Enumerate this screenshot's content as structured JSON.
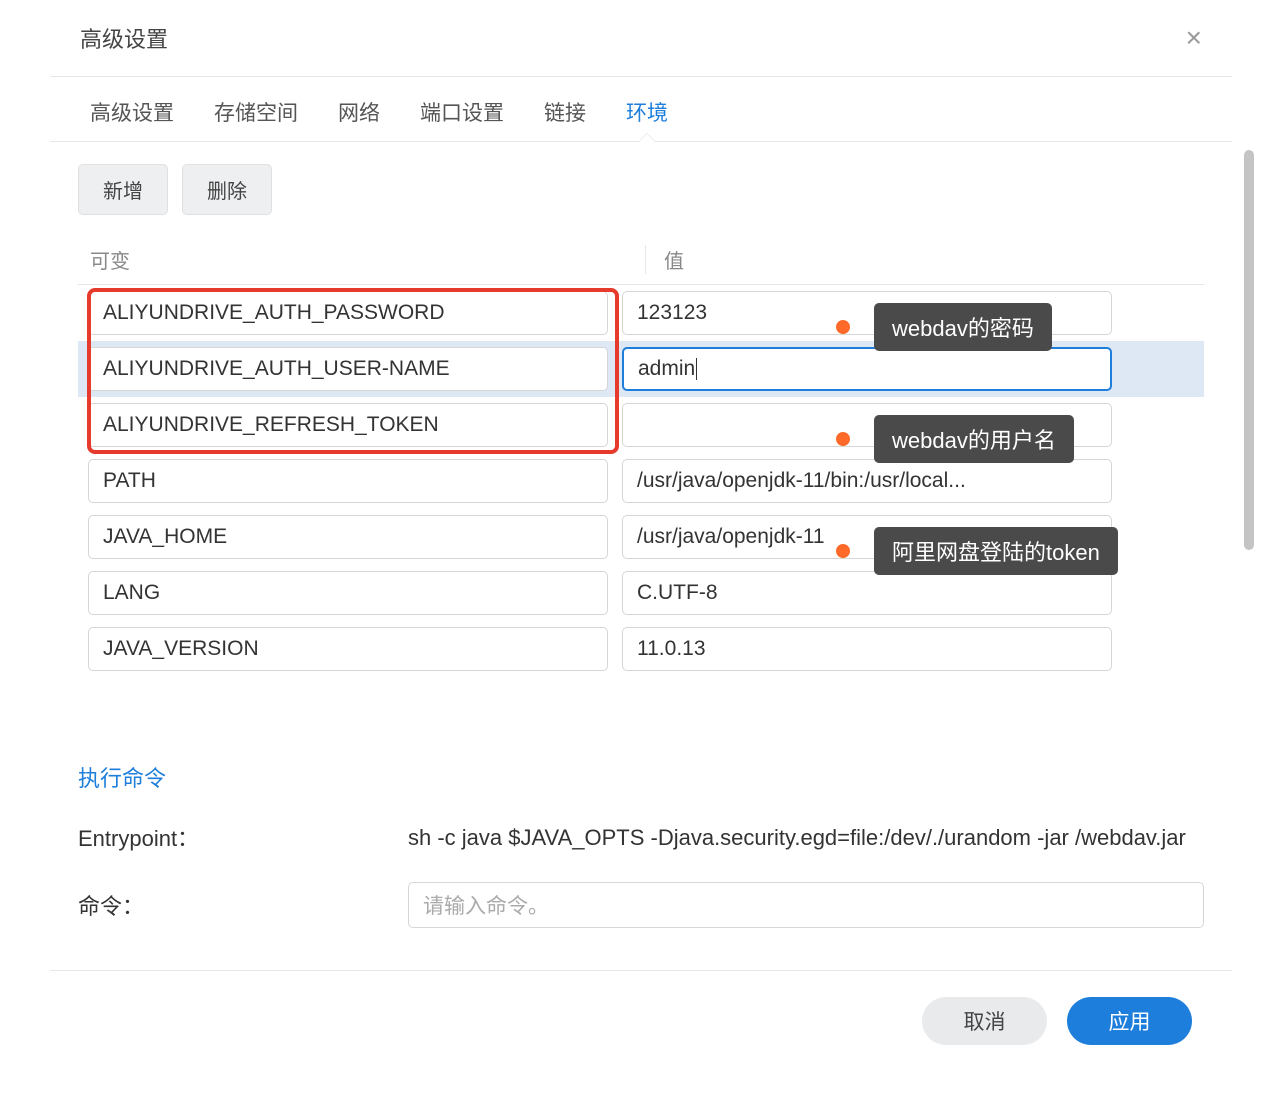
{
  "dialog": {
    "title": "高级设置"
  },
  "tabs": [
    {
      "label": "高级设置",
      "active": false
    },
    {
      "label": "存储空间",
      "active": false
    },
    {
      "label": "网络",
      "active": false
    },
    {
      "label": "端口设置",
      "active": false
    },
    {
      "label": "链接",
      "active": false
    },
    {
      "label": "环境",
      "active": true
    }
  ],
  "toolbar": {
    "add_label": "新增",
    "delete_label": "删除"
  },
  "table": {
    "col_key": "可变",
    "col_value": "值"
  },
  "env_rows": [
    {
      "key": "ALIYUNDRIVE_AUTH_PASSWORD",
      "value": "123123",
      "selected": false,
      "focused": false,
      "annotation": "webdav的密码"
    },
    {
      "key": "ALIYUNDRIVE_AUTH_USER-NAME",
      "value": "admin",
      "selected": true,
      "focused": true,
      "annotation": "webdav的用户名"
    },
    {
      "key": "ALIYUNDRIVE_REFRESH_TOKEN",
      "value": "",
      "selected": false,
      "focused": false,
      "annotation": "阿里网盘登陆的token"
    },
    {
      "key": "PATH",
      "value": "/usr/java/openjdk-11/bin:/usr/local...",
      "selected": false,
      "focused": false,
      "annotation": null
    },
    {
      "key": "JAVA_HOME",
      "value": "/usr/java/openjdk-11",
      "selected": false,
      "focused": false,
      "annotation": null
    },
    {
      "key": "LANG",
      "value": "C.UTF-8",
      "selected": false,
      "focused": false,
      "annotation": null
    },
    {
      "key": "JAVA_VERSION",
      "value": "11.0.13",
      "selected": false,
      "focused": false,
      "annotation": null
    }
  ],
  "exec_link": "执行命令",
  "entrypoint": {
    "label": "Entrypoint：",
    "value": "sh -c java $JAVA_OPTS -Djava.security.egd=file:/dev/./urandom -jar /webdav.jar"
  },
  "command": {
    "label": "命令：",
    "placeholder": "请输入命令。"
  },
  "footer": {
    "cancel": "取消",
    "apply": "应用"
  }
}
